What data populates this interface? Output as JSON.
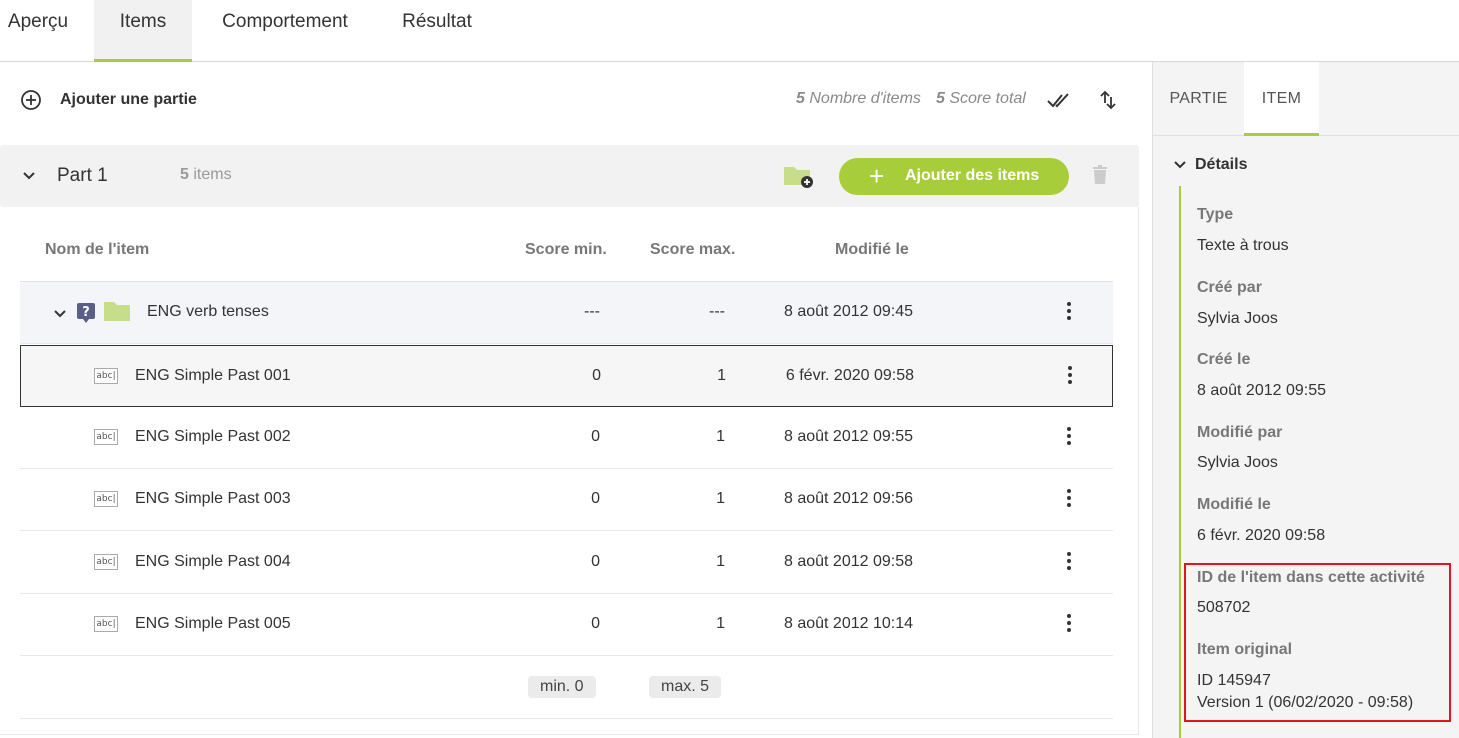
{
  "top_tabs": [
    {
      "label": "Aperçu"
    },
    {
      "label": "Items"
    },
    {
      "label": "Comportement"
    },
    {
      "label": "Résultat"
    }
  ],
  "toolbar": {
    "add_part_label": "Ajouter une partie",
    "items_count": "5",
    "items_count_label": "Nombre d'items",
    "score_total": "5",
    "score_total_label": "Score total"
  },
  "part": {
    "title": "Part 1",
    "count": "5",
    "count_label": "items",
    "add_items_label": "Ajouter des items"
  },
  "table": {
    "headers": {
      "name": "Nom de l'item",
      "min": "Score min.",
      "max": "Score max.",
      "modified": "Modifié le"
    },
    "folder": {
      "name": "ENG verb tenses",
      "min": "---",
      "max": "---",
      "modified": "8 août 2012 09:45",
      "type_icon_glyph": "?"
    },
    "rows": [
      {
        "icon": "abc|",
        "name": "ENG Simple Past 001",
        "min": "0",
        "max": "1",
        "modified": "6 févr. 2020 09:58"
      },
      {
        "icon": "abc|",
        "name": "ENG Simple Past 002",
        "min": "0",
        "max": "1",
        "modified": "8 août 2012 09:55"
      },
      {
        "icon": "abc|",
        "name": "ENG Simple Past 003",
        "min": "0",
        "max": "1",
        "modified": "8 août 2012 09:56"
      },
      {
        "icon": "abc|",
        "name": "ENG Simple Past 004",
        "min": "0",
        "max": "1",
        "modified": "8 août 2012 09:58"
      },
      {
        "icon": "abc|",
        "name": "ENG Simple Past 005",
        "min": "0",
        "max": "1",
        "modified": "8 août 2012 10:14"
      }
    ],
    "summary": {
      "min": "min. 0",
      "max": "max. 5"
    }
  },
  "side": {
    "tabs": [
      {
        "label": "PARTIE"
      },
      {
        "label": "ITEM"
      }
    ],
    "details_label": "Détails",
    "fields": [
      {
        "label": "Type",
        "value": "Texte à trous"
      },
      {
        "label": "Créé par",
        "value": "Sylvia Joos"
      },
      {
        "label": "Créé le",
        "value": "8 août 2012 09:55"
      },
      {
        "label": "Modifié par",
        "value": "Sylvia Joos"
      },
      {
        "label": "Modifié le",
        "value": "6 févr. 2020 09:58"
      },
      {
        "label": "ID de l'item dans cette activité",
        "value": "508702"
      },
      {
        "label": "Item original",
        "value": "ID 145947",
        "value2": "Version 1 (06/02/2020 - 09:58)"
      }
    ]
  },
  "colors": {
    "accent": "#a8cd3b",
    "highlight": "#e3141c",
    "selected_border": "#333333"
  }
}
